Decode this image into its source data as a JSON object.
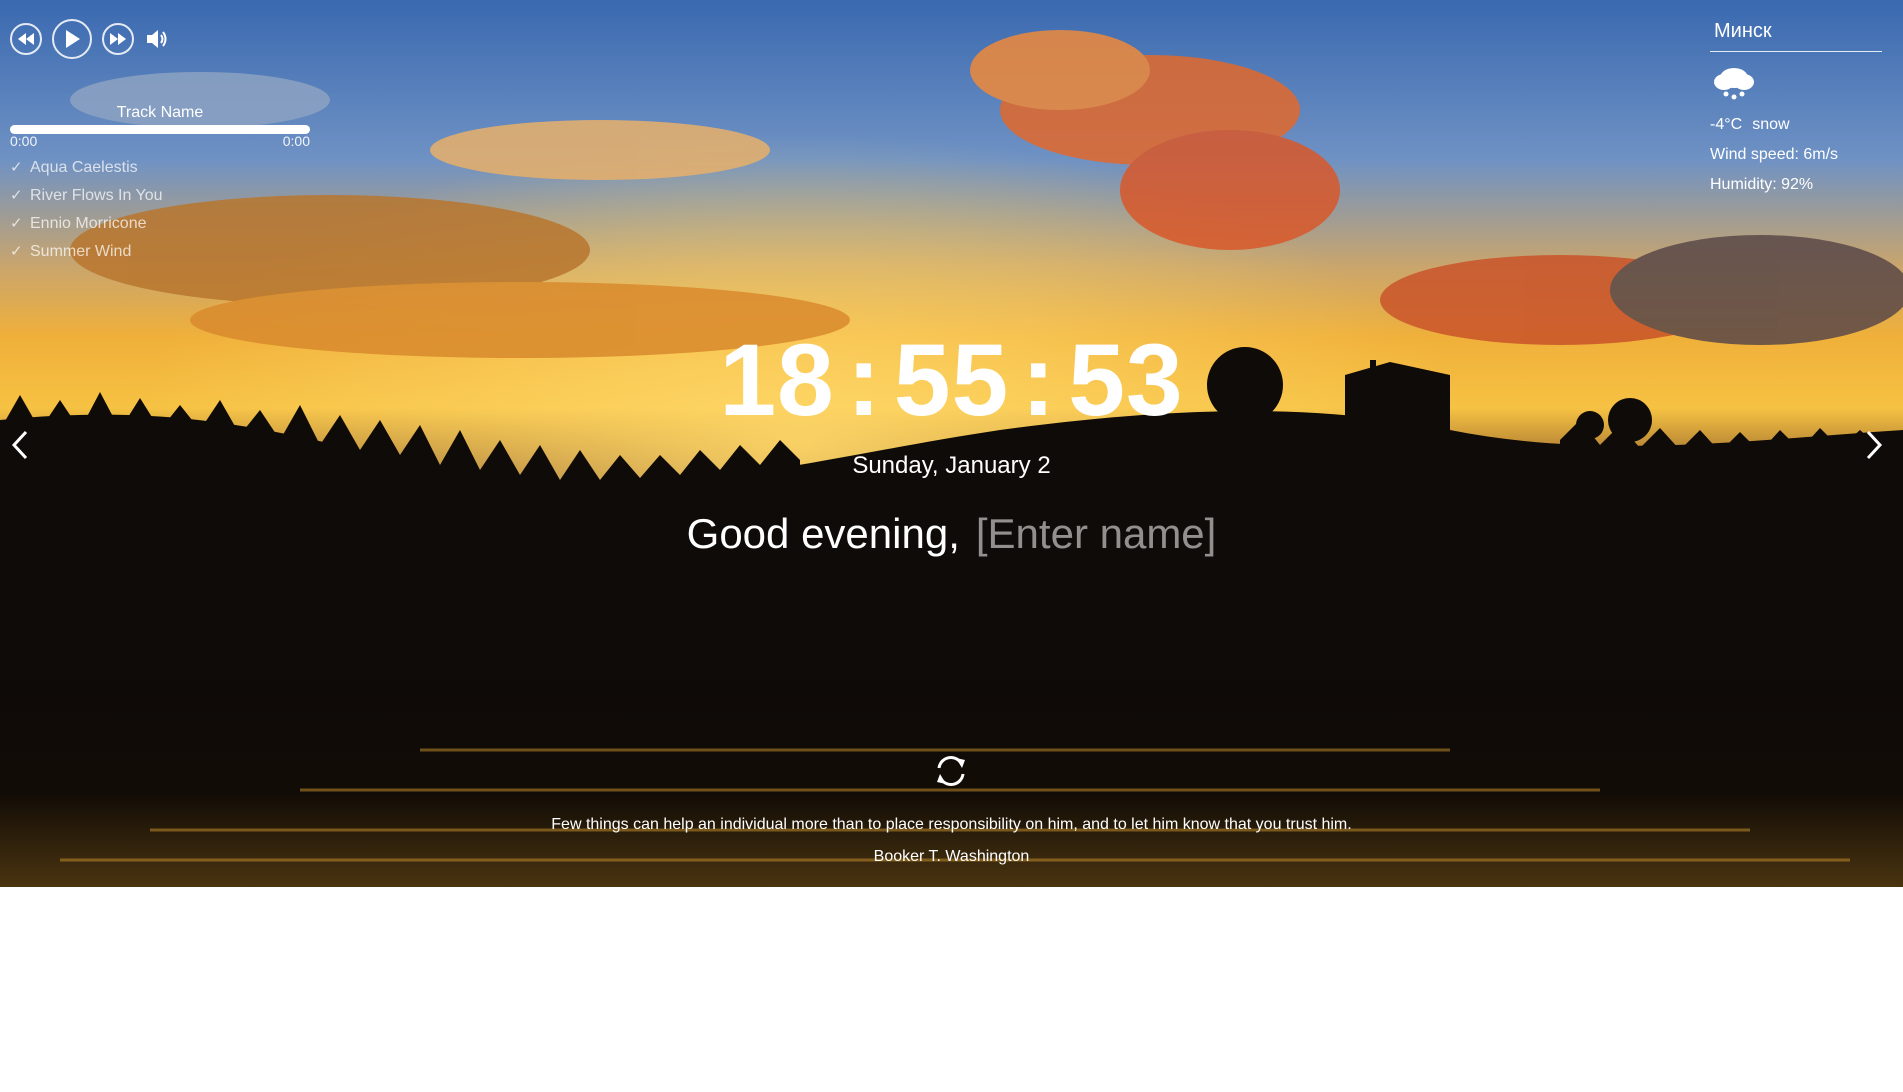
{
  "player": {
    "track_name": "Track Name",
    "current_time": "0:00",
    "duration": "0:00",
    "progress_fraction": 1.0,
    "playlist": [
      {
        "title": "Aqua Caelestis"
      },
      {
        "title": "River Flows In You"
      },
      {
        "title": "Ennio Morricone"
      },
      {
        "title": "Summer Wind"
      }
    ],
    "icons": [
      "rewind-icon",
      "play-icon",
      "fast-forward-icon",
      "volume-icon"
    ]
  },
  "weather": {
    "city": "Минск",
    "icon": "snow-cloud-icon",
    "temperature": "-4°C",
    "description": "snow",
    "wind": "Wind speed: 6m/s",
    "humidity": "Humidity: 92%"
  },
  "clock": {
    "hours": "18",
    "minutes": "55",
    "seconds": "53",
    "separator": ":",
    "date": "Sunday, January 2"
  },
  "greeting": {
    "text": "Good evening,",
    "name": "[Enter name]"
  },
  "quote": {
    "text": "Few things can help an individual more than to place responsibility on him, and to let him know that you trust him.",
    "author": "Booker T. Washington"
  },
  "colors": {
    "text": "#ffffff",
    "sky_top": "#3f6fb4",
    "sunset": "#f3a52b",
    "cloud": "#e8692b",
    "ground": "#0d0a08"
  }
}
